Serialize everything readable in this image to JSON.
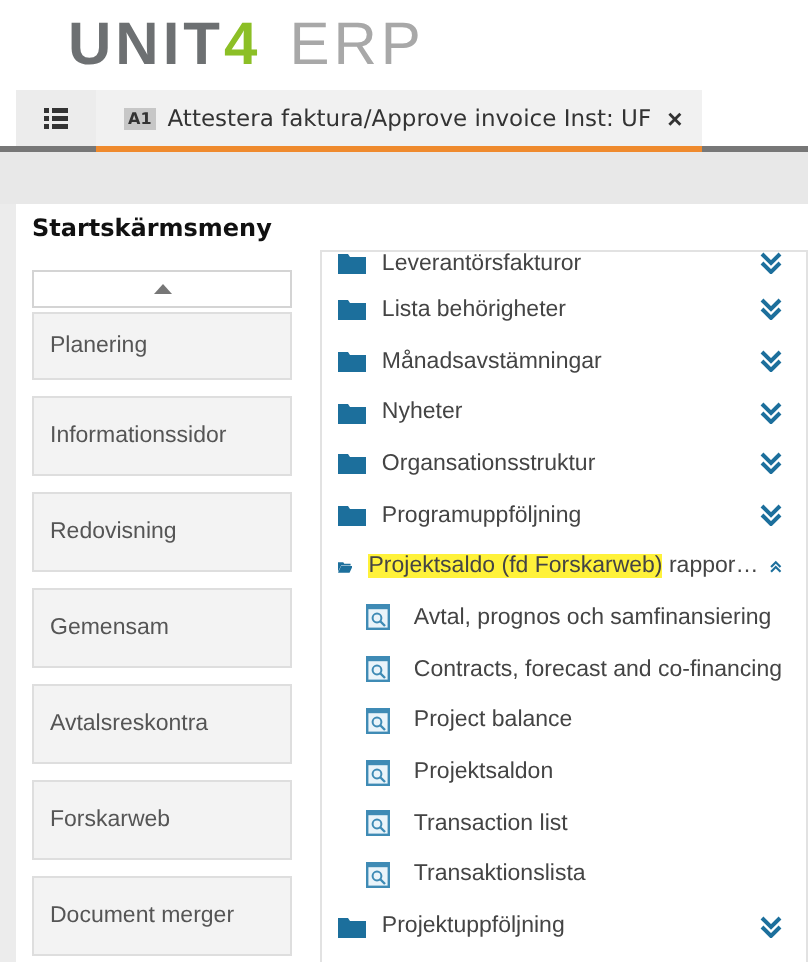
{
  "logo": {
    "brand": "UNIT",
    "mark": "4",
    "product": "ERP"
  },
  "tabs": [
    {
      "badge": "A1",
      "title": "Attestera faktura/Approve invoice Inst: UF",
      "close": "×",
      "selected": true
    }
  ],
  "start_menu": {
    "title": "Startskärmsmeny",
    "items": [
      {
        "label": "Planering"
      },
      {
        "label": "Informationssidor"
      },
      {
        "label": "Redovisning"
      },
      {
        "label": "Gemensam"
      },
      {
        "label": "Avtalsreskontra"
      },
      {
        "label": "Forskarweb"
      },
      {
        "label": "Document merger"
      }
    ]
  },
  "folders": [
    {
      "label": "Leverantörsfakturor",
      "expanded": false
    },
    {
      "label": "Lista behörigheter",
      "expanded": false
    },
    {
      "label": "Månadsavstämningar",
      "expanded": false
    },
    {
      "label": "Nyheter",
      "expanded": false
    },
    {
      "label": "Organsationsstruktur",
      "expanded": false
    },
    {
      "label": "Programuppföljning",
      "expanded": false
    },
    {
      "highlighted": "Projektsaldo (fd Forskarweb)",
      "label": "rappor…",
      "expanded": true,
      "children": [
        {
          "label": "Avtal, prognos och samfinansiering"
        },
        {
          "label": "Contracts, forecast and co-financing"
        },
        {
          "label": "Project balance"
        },
        {
          "label": "Projektsaldon"
        },
        {
          "label": "Transaction list"
        },
        {
          "label": "Transaktionslista"
        }
      ]
    },
    {
      "label": "Projektuppföljning",
      "expanded": false
    }
  ]
}
